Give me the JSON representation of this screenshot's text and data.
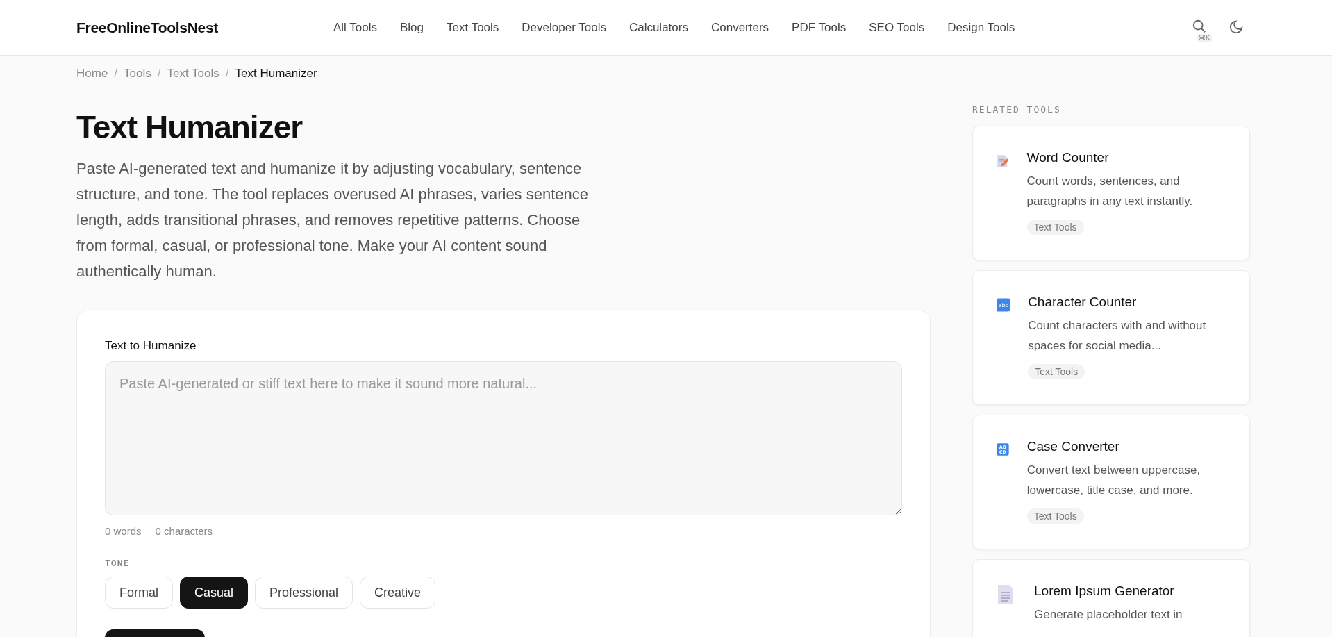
{
  "header": {
    "logo": "FreeOnlineToolsNest",
    "nav": [
      "All Tools",
      "Blog",
      "Text Tools",
      "Developer Tools",
      "Calculators",
      "Converters",
      "PDF Tools",
      "SEO Tools",
      "Design Tools"
    ],
    "search_shortcut": "⌘K"
  },
  "breadcrumb": [
    {
      "label": "Home",
      "current": false
    },
    {
      "label": "Tools",
      "current": false
    },
    {
      "label": "Text Tools",
      "current": false
    },
    {
      "label": "Text Humanizer",
      "current": true
    }
  ],
  "breadcrumb_separator": "/",
  "title": "Text Humanizer",
  "description": "Paste AI-generated text and humanize it by adjusting vocabulary, sentence structure, and tone. The tool replaces overused AI phrases, varies sentence length, adds transitional phrases, and removes repetitive patterns. Choose from formal, casual, or professional tone. Make your AI content sound authentically human.",
  "tool": {
    "input_label": "Text to Humanize",
    "placeholder": "Paste AI-generated or stiff text here to make it sound more natural...",
    "word_count": "0 words",
    "char_count": "0 characters",
    "tone_label": "TONE",
    "tones": [
      {
        "label": "Formal",
        "selected": false
      },
      {
        "label": "Casual",
        "selected": true
      },
      {
        "label": "Professional",
        "selected": false
      },
      {
        "label": "Creative",
        "selected": false
      }
    ]
  },
  "related": {
    "heading": "RELATED TOOLS",
    "items": [
      {
        "kind": "document-pencil",
        "title": "Word Counter",
        "description": "Count words, sentences, and paragraphs in any text instantly.",
        "tag": "Text Tools"
      },
      {
        "kind": "abc",
        "icon_text": [
          "abc"
        ],
        "title": "Character Counter",
        "description": "Count characters with and without spaces for social media...",
        "tag": "Text Tools"
      },
      {
        "kind": "abcd",
        "icon_text": [
          "AB",
          "CD"
        ],
        "title": "Case Converter",
        "description": "Convert text between uppercase, lowercase, title case, and more.",
        "tag": "Text Tools"
      },
      {
        "kind": "document",
        "title": "Lorem Ipsum Generator",
        "description": "Generate placeholder text in"
      }
    ]
  }
}
